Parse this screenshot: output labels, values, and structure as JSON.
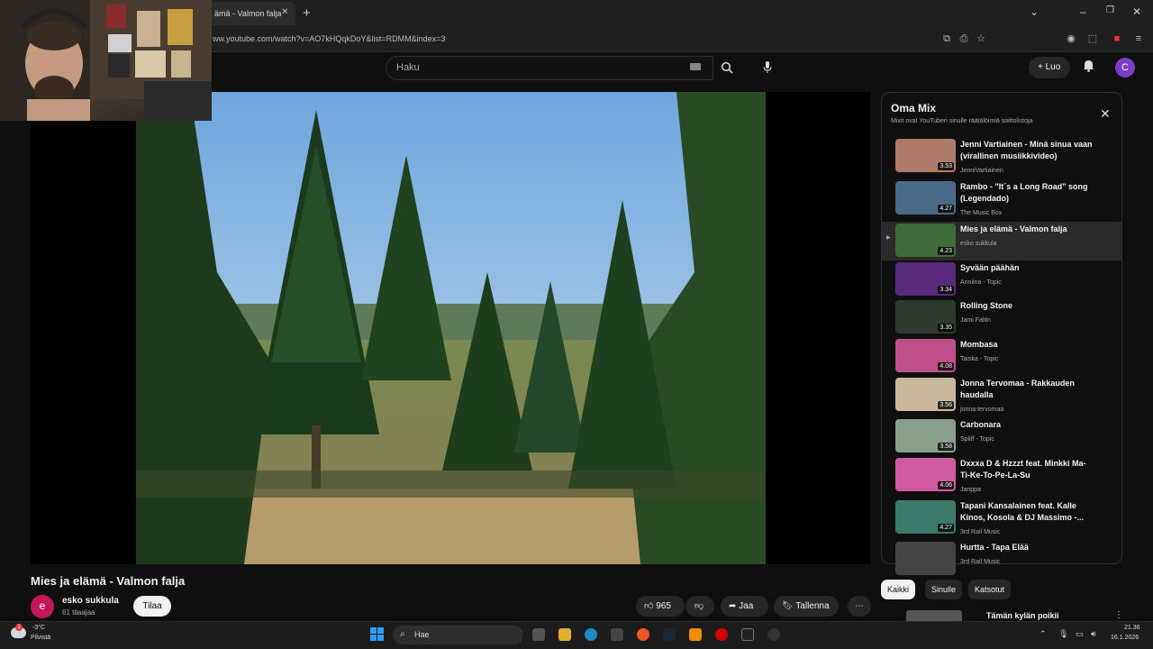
{
  "browser": {
    "tab_title": "ämä - Valmon falja",
    "url": "ww.youtube.com/watch?v=AO7kHQqkDoY&list=RDMM&index=3"
  },
  "youtube": {
    "search_placeholder": "Haku",
    "create_label": "Luo",
    "user_initial": "C"
  },
  "video": {
    "title": "Mies ja elämä - Valmon falja",
    "channel": "esko sukkula",
    "channel_initial": "e",
    "subscribers": "61 tilaajaa",
    "subscribe_label": "Tilaa",
    "likes": "965",
    "share_label": "Jaa",
    "save_label": "Tallenna"
  },
  "mix": {
    "title": "Oma Mix",
    "subtitle": "Mixit ovat YouTuben sinulle räätälöimiä soittolistoja",
    "items": [
      {
        "title": "Jenni Vartiainen - Minä sinua vaan (virallinen musiikkivideo)",
        "channel": "JenniVartiainen",
        "duration": "3.53",
        "color": "#b07a6a"
      },
      {
        "title": "Rambo - \"It´s a Long Road\" song (Legendado)",
        "channel": "The Music Box",
        "duration": "4.27",
        "color": "#4a6a8a"
      },
      {
        "title": "Mies ja elämä - Valmon falja",
        "channel": "esko sukkula",
        "duration": "4.23",
        "color": "#3d6b3a",
        "active": true
      },
      {
        "title": "Syvään päähän",
        "channel": "Anniina - Topic",
        "duration": "3.34",
        "color": "#5a2b7a"
      },
      {
        "title": "Rolling Stone",
        "channel": "Jami Faltin",
        "duration": "3.35",
        "color": "#2e3a2e"
      },
      {
        "title": "Mombasa",
        "channel": "Taiska - Topic",
        "duration": "4.08",
        "color": "#c0508a"
      },
      {
        "title": "Jonna Tervomaa - Rakkauden haudalla",
        "channel": "jonna tervomaa",
        "duration": "3.56",
        "color": "#c9b99a"
      },
      {
        "title": "Carbonara",
        "channel": "Spliff - Topic",
        "duration": "3.58",
        "color": "#8aa08a"
      },
      {
        "title": "Dxxxa D & Hzzzt feat. Minkki Ma-Ti-Ke-To-Pe-La-Su",
        "channel": "Janppa",
        "duration": "4.06",
        "color": "#d05aa0"
      },
      {
        "title": "Tapani Kansalainen feat. Kalle Kinos, Kosola & DJ Massimo -...",
        "channel": "3rd Rail Music",
        "duration": "4.27",
        "color": "#3a7a6a"
      },
      {
        "title": "Hurtta - Tapa Elää",
        "channel": "3rd Rail Music",
        "duration": "",
        "color": "#444444"
      }
    ]
  },
  "chips": [
    "Kaikki",
    "Sinulle",
    "Katsotut"
  ],
  "recommended_title": "Tämän kylän poikii",
  "taskbar": {
    "temp": "-3°C",
    "weather": "Pilvistä",
    "weather_badge": "1",
    "search_label": "Hae",
    "time": "21.36",
    "date": "16.1.2026"
  }
}
